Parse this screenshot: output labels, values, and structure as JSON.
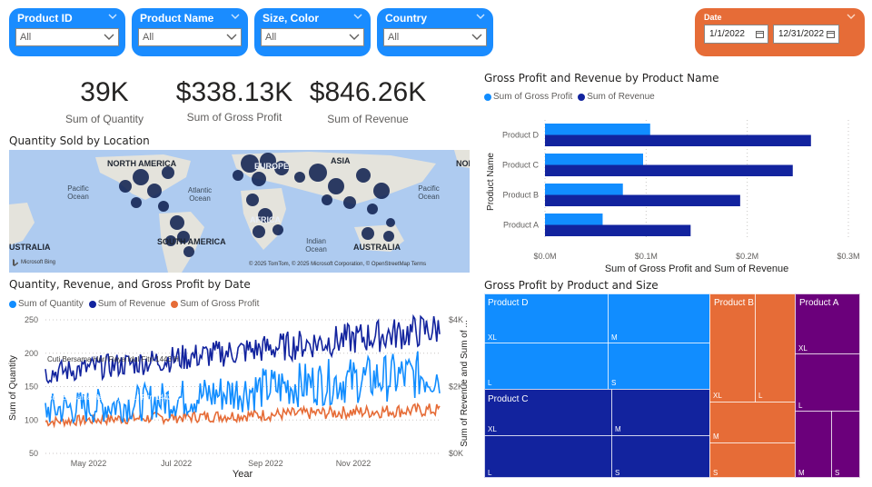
{
  "slicers": [
    {
      "label": "Product ID",
      "value": "All"
    },
    {
      "label": "Product Name",
      "value": "All"
    },
    {
      "label": "Size, Color",
      "value": "All"
    },
    {
      "label": "Country",
      "value": "All"
    }
  ],
  "date_slicer": {
    "label": "Date",
    "start": "1/1/2022",
    "end": "12/31/2022"
  },
  "kpis": [
    {
      "value": "39K",
      "label": "Sum of Quantity"
    },
    {
      "value": "$338.13K",
      "label": "Sum of Gross Profit"
    },
    {
      "value": "$846.26K",
      "label": "Sum of Revenue"
    }
  ],
  "map": {
    "title": "Quantity Sold by Location",
    "continents": [
      "NORTH AMERICA",
      "EUROPE",
      "ASIA",
      "AFRICA",
      "SOUTH AMERICA",
      "AUSTRALIA",
      "USTRALIA",
      "NOR"
    ],
    "oceans": [
      "Pacific Ocean",
      "Atlantic Ocean",
      "Indian Ocean",
      "Pacific Ocean"
    ],
    "bing": "Microsoft Bing",
    "attribution": "© 2025 TomTom, © 2025 Microsoft Corporation, © OpenStreetMap  Terms"
  },
  "colors": {
    "quantity": "#118dff",
    "revenue": "#12239e",
    "gross_profit": "#e66c37",
    "product_a": "#6b007b",
    "slicer": "#1a8cff",
    "date_slicer": "#e66c37"
  },
  "bar_chart": {
    "title": "Gross Profit and Revenue by Product Name",
    "legend": [
      "Sum of Gross Profit",
      "Sum of Revenue"
    ],
    "xlabel": "Sum of Gross Profit and Sum of Revenue",
    "ylabel": "Product Name",
    "xticks": [
      "$0.0M",
      "$0.1M",
      "$0.2M",
      "$0.3M"
    ]
  },
  "line_chart": {
    "title": "Quantity, Revenue, and Gross Profit by Date",
    "legend": [
      "Sum of Quantity",
      "Sum of Revenue",
      "Sum of Gross Profit"
    ],
    "ylabel_left": "Sum of Quantity",
    "ylabel_right": "Sum of Revenue and Sum of ...",
    "xlabel": "Year",
    "yticks_left": [
      "250",
      "200",
      "150",
      "100",
      "50"
    ],
    "yticks_right": [
      "$4K",
      "$2K",
      "$0K"
    ],
    "xticks": [
      "May 2022",
      "Jul 2022",
      "Sep 2022",
      "Nov 2022"
    ],
    "annotations": [
      "Cuti Bersama Hari Raya Idul Fitri 1443 H",
      "Cuti Bersama Hari Raya Idul Fitri 1443 H"
    ]
  },
  "treemap": {
    "title": "Gross Profit by Product and Size",
    "groups": [
      {
        "name": "Product D",
        "sizes": [
          "XL",
          "M",
          "L",
          "S"
        ]
      },
      {
        "name": "Product C",
        "sizes": [
          "XL",
          "M",
          "L",
          "S"
        ]
      },
      {
        "name": "Product B",
        "sizes": [
          "XL",
          "L",
          "M",
          "S"
        ]
      },
      {
        "name": "Product A",
        "sizes": [
          "XL",
          "L",
          "M",
          "S"
        ]
      }
    ]
  },
  "chart_data": [
    {
      "type": "bar",
      "title": "Gross Profit and Revenue by Product Name",
      "categories": [
        "Product D",
        "Product C",
        "Product B",
        "Product A"
      ],
      "series": [
        {
          "name": "Sum of Gross Profit",
          "values": [
            0.104,
            0.097,
            0.077,
            0.057
          ]
        },
        {
          "name": "Sum of Revenue",
          "values": [
            0.263,
            0.245,
            0.193,
            0.144
          ]
        }
      ],
      "xlabel": "Sum of Gross Profit and Sum of Revenue",
      "ylabel": "Product Name",
      "xlim": [
        0,
        0.3
      ],
      "units": "$M",
      "orientation": "horizontal",
      "legend": "top-left"
    },
    {
      "type": "line",
      "title": "Quantity, Revenue, and Gross Profit by Date",
      "x": [
        "2022-04-01",
        "2022-05-01",
        "2022-06-01",
        "2022-07-01",
        "2022-08-01",
        "2022-09-01",
        "2022-10-01",
        "2022-11-01",
        "2022-12-01",
        "2022-12-31"
      ],
      "series": [
        {
          "name": "Sum of Quantity",
          "axis": "left",
          "values": [
            115,
            120,
            125,
            132,
            140,
            148,
            155,
            160,
            165,
            170
          ]
        },
        {
          "name": "Sum of Revenue",
          "axis": "right",
          "values": [
            2400,
            2550,
            2700,
            2850,
            3000,
            3150,
            3300,
            3450,
            3600,
            3750
          ]
        },
        {
          "name": "Sum of Gross Profit",
          "axis": "right",
          "values": [
            950,
            1000,
            1050,
            1080,
            1120,
            1160,
            1200,
            1240,
            1280,
            1300
          ]
        }
      ],
      "xlabel": "Year",
      "ylabel": "Sum of Quantity",
      "ylim": [
        50,
        250
      ],
      "y2lim": [
        0,
        4000
      ],
      "legend": "top-left"
    },
    {
      "type": "treemap",
      "title": "Gross Profit by Product and Size",
      "groups": [
        {
          "name": "Product D",
          "children": [
            {
              "name": "XL",
              "value": 1
            },
            {
              "name": "M",
              "value": 1
            },
            {
              "name": "L",
              "value": 1
            },
            {
              "name": "S",
              "value": 1
            }
          ]
        },
        {
          "name": "Product C",
          "children": [
            {
              "name": "XL",
              "value": 1
            },
            {
              "name": "M",
              "value": 1
            },
            {
              "name": "L",
              "value": 1
            },
            {
              "name": "S",
              "value": 1
            }
          ]
        },
        {
          "name": "Product B",
          "children": [
            {
              "name": "XL",
              "value": 1
            },
            {
              "name": "L",
              "value": 1
            },
            {
              "name": "M",
              "value": 1
            },
            {
              "name": "S",
              "value": 1
            }
          ]
        },
        {
          "name": "Product A",
          "children": [
            {
              "name": "XL",
              "value": 1
            },
            {
              "name": "L",
              "value": 1
            },
            {
              "name": "M",
              "value": 1
            },
            {
              "name": "S",
              "value": 1
            }
          ]
        }
      ]
    }
  ]
}
